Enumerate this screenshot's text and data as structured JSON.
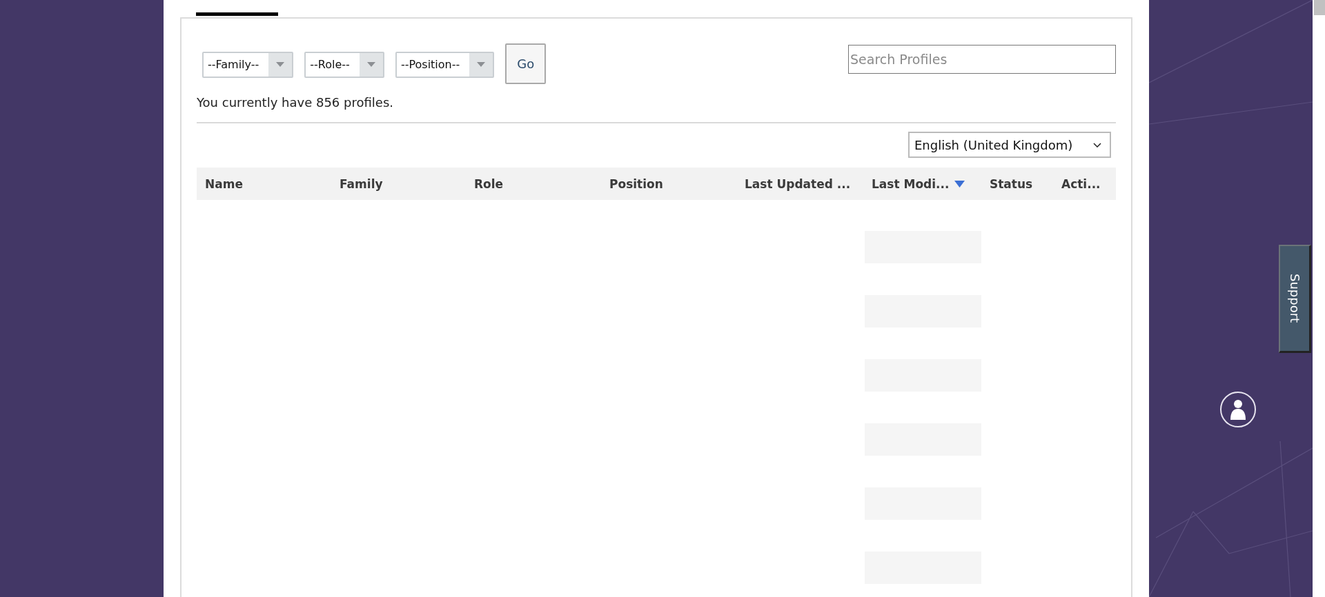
{
  "filters": [
    {
      "placeholder": "--Family--"
    },
    {
      "placeholder": "--Role--"
    },
    {
      "placeholder": "--Position--"
    }
  ],
  "go_button": "Go",
  "search": {
    "placeholder": "Search Profiles"
  },
  "profile_count": "You currently have 856 profiles.",
  "language": "English (United Kingdom)",
  "table": {
    "columns": [
      {
        "label": "Name",
        "sorted": false
      },
      {
        "label": "Family",
        "sorted": false
      },
      {
        "label": "Role",
        "sorted": false
      },
      {
        "label": "Position",
        "sorted": false
      },
      {
        "label": "Last Updated ...",
        "sorted": false
      },
      {
        "label": "Last Modi...",
        "sorted": true
      },
      {
        "label": "Status",
        "sorted": false
      },
      {
        "label": "Acti...",
        "sorted": false
      }
    ]
  },
  "support_tab": "Support"
}
